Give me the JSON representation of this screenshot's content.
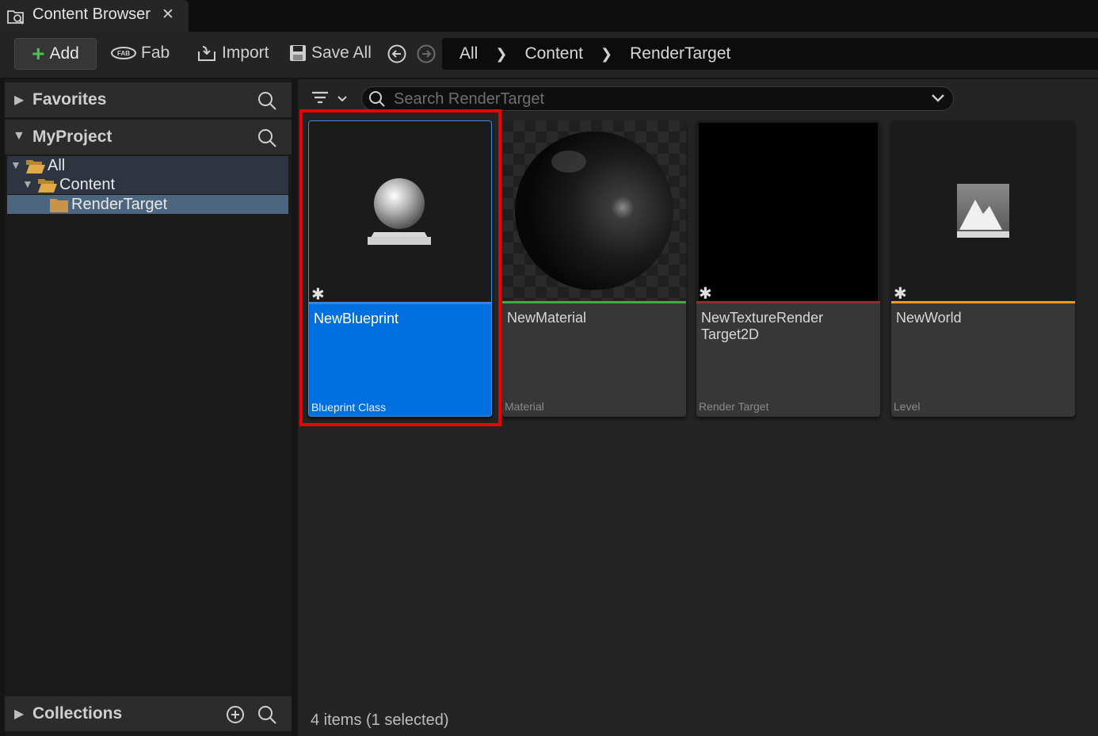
{
  "tab": {
    "title": "Content Browser",
    "close": "✕"
  },
  "toolbar": {
    "add": "Add",
    "fab": "Fab",
    "import": "Import",
    "save_all": "Save All"
  },
  "breadcrumb": [
    "All",
    "Content",
    "RenderTarget"
  ],
  "left": {
    "favorites": "Favorites",
    "project": "MyProject",
    "tree": {
      "all": "All",
      "content": "Content",
      "render_target": "RenderTarget"
    },
    "collections": "Collections"
  },
  "search": {
    "placeholder": "Search RenderTarget"
  },
  "assets": [
    {
      "name": "NewBlueprint",
      "type": "Blueprint Class",
      "color": "#2e6fd8"
    },
    {
      "name": "NewMaterial",
      "type": "Material",
      "color": "#3fae3f"
    },
    {
      "name": "NewTextureRender Target2D",
      "type": "Render Target",
      "color": "#8a3232"
    },
    {
      "name": "NewWorld",
      "type": "Level",
      "color": "#f09a1a"
    }
  ],
  "status": "4 items (1 selected)",
  "colors": {
    "selection": "#0070e0",
    "highlight": "#ee0000"
  }
}
